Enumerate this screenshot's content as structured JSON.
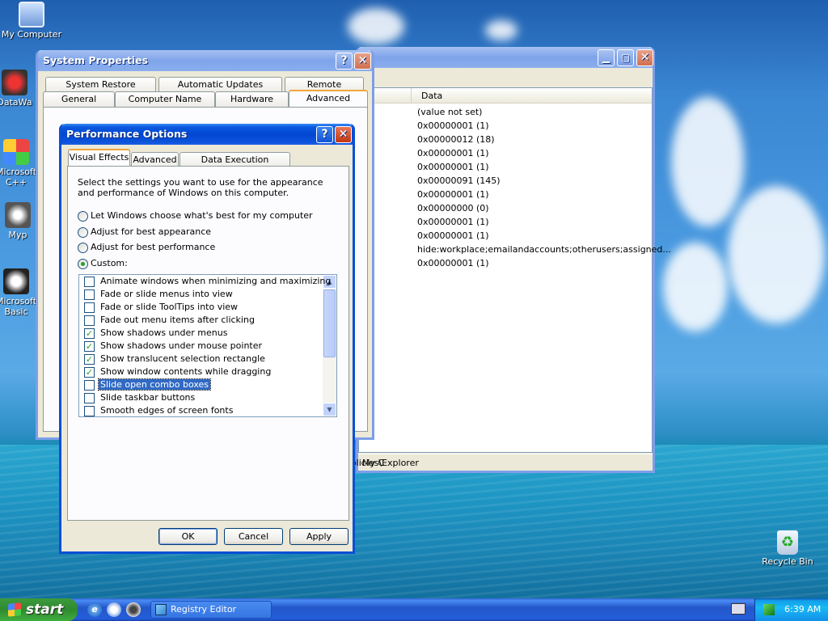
{
  "desktop": {
    "icons": [
      {
        "label": "My Computer",
        "icon": "my-computer-icon"
      },
      {
        "label": "DataWa",
        "icon": "shortcut-icon"
      },
      {
        "label": "Microsoft C++",
        "icon": "shortcut-icon"
      },
      {
        "label": "Myp",
        "icon": "shortcut-icon"
      },
      {
        "label": "Microsoft Basic",
        "icon": "shortcut-icon"
      },
      {
        "label": "Recycle Bin",
        "icon": "recycle-bin-icon"
      }
    ]
  },
  "registry": {
    "col_data": "Data",
    "values": [
      "(value not set)",
      "0x00000001 (1)",
      "0x00000012 (18)",
      "0x00000001 (1)",
      "0x00000001 (1)",
      "0x00000091 (145)",
      "0x00000001 (1)",
      "0x00000000 (0)",
      "0x00000001 (1)",
      "0x00000001 (1)",
      "hide:workplace;emailandaccounts;otherusers;assigned...",
      "0x00000001 (1)"
    ],
    "status_left": "My C",
    "status_right": "n\\Policies\\Explorer"
  },
  "sysprops": {
    "title": "System Properties",
    "tabs_row1": [
      "System Restore",
      "Automatic Updates",
      "Remote"
    ],
    "tabs_row2": [
      "General",
      "Computer Name",
      "Hardware",
      "Advanced"
    ]
  },
  "perf": {
    "title": "Performance Options",
    "tabs": [
      "Visual Effects",
      "Advanced",
      "Data Execution Prevention"
    ],
    "intro": "Select the settings you want to use for the appearance and performance of Windows on this computer.",
    "radios": [
      "Let Windows choose what's best for my computer",
      "Adjust for best appearance",
      "Adjust for best performance",
      "Custom:"
    ],
    "selected_radio": "Custom:",
    "options": [
      {
        "label": "Animate windows when minimizing and maximizing",
        "checked": false
      },
      {
        "label": "Fade or slide menus into view",
        "checked": false
      },
      {
        "label": "Fade or slide ToolTips into view",
        "checked": false
      },
      {
        "label": "Fade out menu items after clicking",
        "checked": false
      },
      {
        "label": "Show shadows under menus",
        "checked": true
      },
      {
        "label": "Show shadows under mouse pointer",
        "checked": true
      },
      {
        "label": "Show translucent selection rectangle",
        "checked": true
      },
      {
        "label": "Show window contents while dragging",
        "checked": true
      },
      {
        "label": "Slide open combo boxes",
        "checked": false,
        "selected": true
      },
      {
        "label": "Slide taskbar buttons",
        "checked": false
      },
      {
        "label": "Smooth edges of screen fonts",
        "checked": false
      }
    ],
    "buttons": {
      "ok": "OK",
      "cancel": "Cancel",
      "apply": "Apply"
    }
  },
  "taskbar": {
    "start_label": "start",
    "task": "Registry Editor",
    "clock": "6:39 AM"
  }
}
